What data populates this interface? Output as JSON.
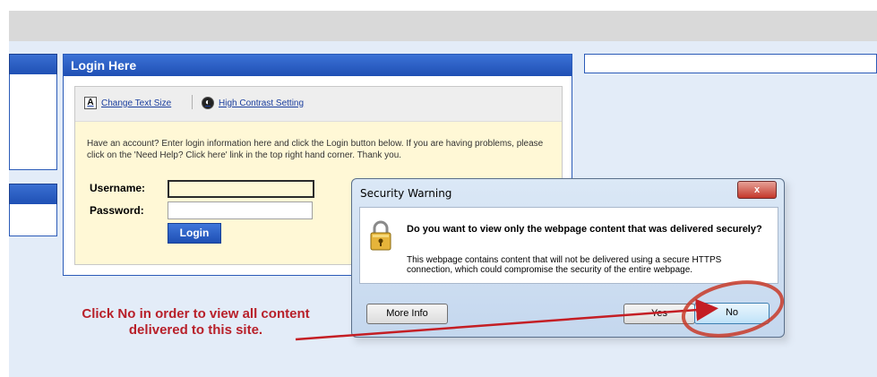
{
  "login": {
    "title": "Login Here",
    "tools": {
      "text_size_label": "Change Text Size",
      "contrast_label": "High Contrast Setting"
    },
    "description": "Have an account? Enter login information here and click the Login button below. If you are having problems, please click on the 'Need Help? Click here' link in the top right hand corner. Thank you.",
    "username_label": "Username:",
    "username_value": "",
    "password_label": "Password:",
    "password_value": "",
    "button_label": "Login"
  },
  "dialog": {
    "title": "Security Warning",
    "close_label": "x",
    "question": "Do you want to view only the webpage content that was delivered securely?",
    "detail": "This webpage contains content that will not be delivered using a secure HTTPS connection, which could compromise the security of the entire webpage.",
    "more_info_label": "More Info",
    "yes_label": "Yes",
    "no_label": "No"
  },
  "annotation": {
    "text": "Click No in order to view all content delivered to this site.",
    "color": "#b8202a"
  },
  "icons": {
    "text_size": "text-size-icon",
    "contrast": "contrast-icon",
    "lock": "lock-icon"
  },
  "colors": {
    "panel_blue": "#1f4fb4",
    "page_bg": "#e3ecf8",
    "form_bg": "#fff8d6"
  }
}
